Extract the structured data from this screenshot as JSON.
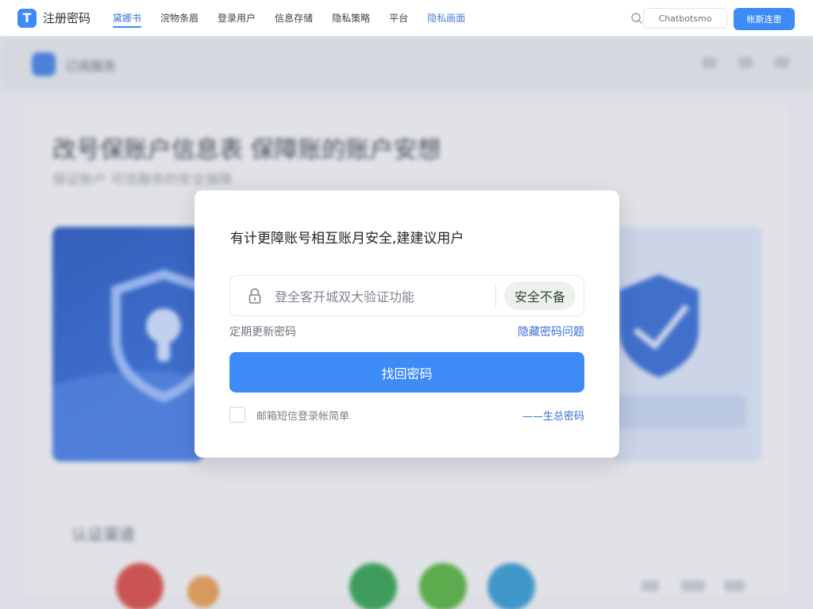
{
  "brand": {
    "logo_glyph": "T",
    "name": "注册密码"
  },
  "nav": {
    "items": [
      {
        "label": "黛娜书",
        "active": true
      },
      {
        "label": "浣物条眉",
        "active": false
      },
      {
        "label": "登录用户",
        "active": false
      },
      {
        "label": "信息存储",
        "active": false
      },
      {
        "label": "隐私策略",
        "active": false
      },
      {
        "label": "平台",
        "active": false
      },
      {
        "label": "隐私画面",
        "active": false
      }
    ]
  },
  "search": {
    "placeholder": "Chatbotsmo",
    "icon": "search-icon"
  },
  "top_button": {
    "label": "帐斯连患"
  },
  "background": {
    "logo_text": "订阅服务",
    "title": "改号保账户信息表 保障账的账户安想",
    "subtitle": "保证账户  可信服务的安全保障",
    "section_title": "认证渠道"
  },
  "dialog": {
    "title": "有计更障账号相互账月安全,建建议用户",
    "field_text": "登全客开城双大验证功能",
    "field_badge": "安全不备",
    "hint_left": "定期更新密码",
    "hint_link": "隐藏密码问题",
    "primary_button": "找回密码",
    "checkbox_label": "邮箱短信登录帐简单",
    "footer_link": "——生总密码"
  },
  "colors": {
    "accent": "#3d8bf6",
    "link": "#3a6fd8",
    "badge_bg": "#edf1ec"
  }
}
